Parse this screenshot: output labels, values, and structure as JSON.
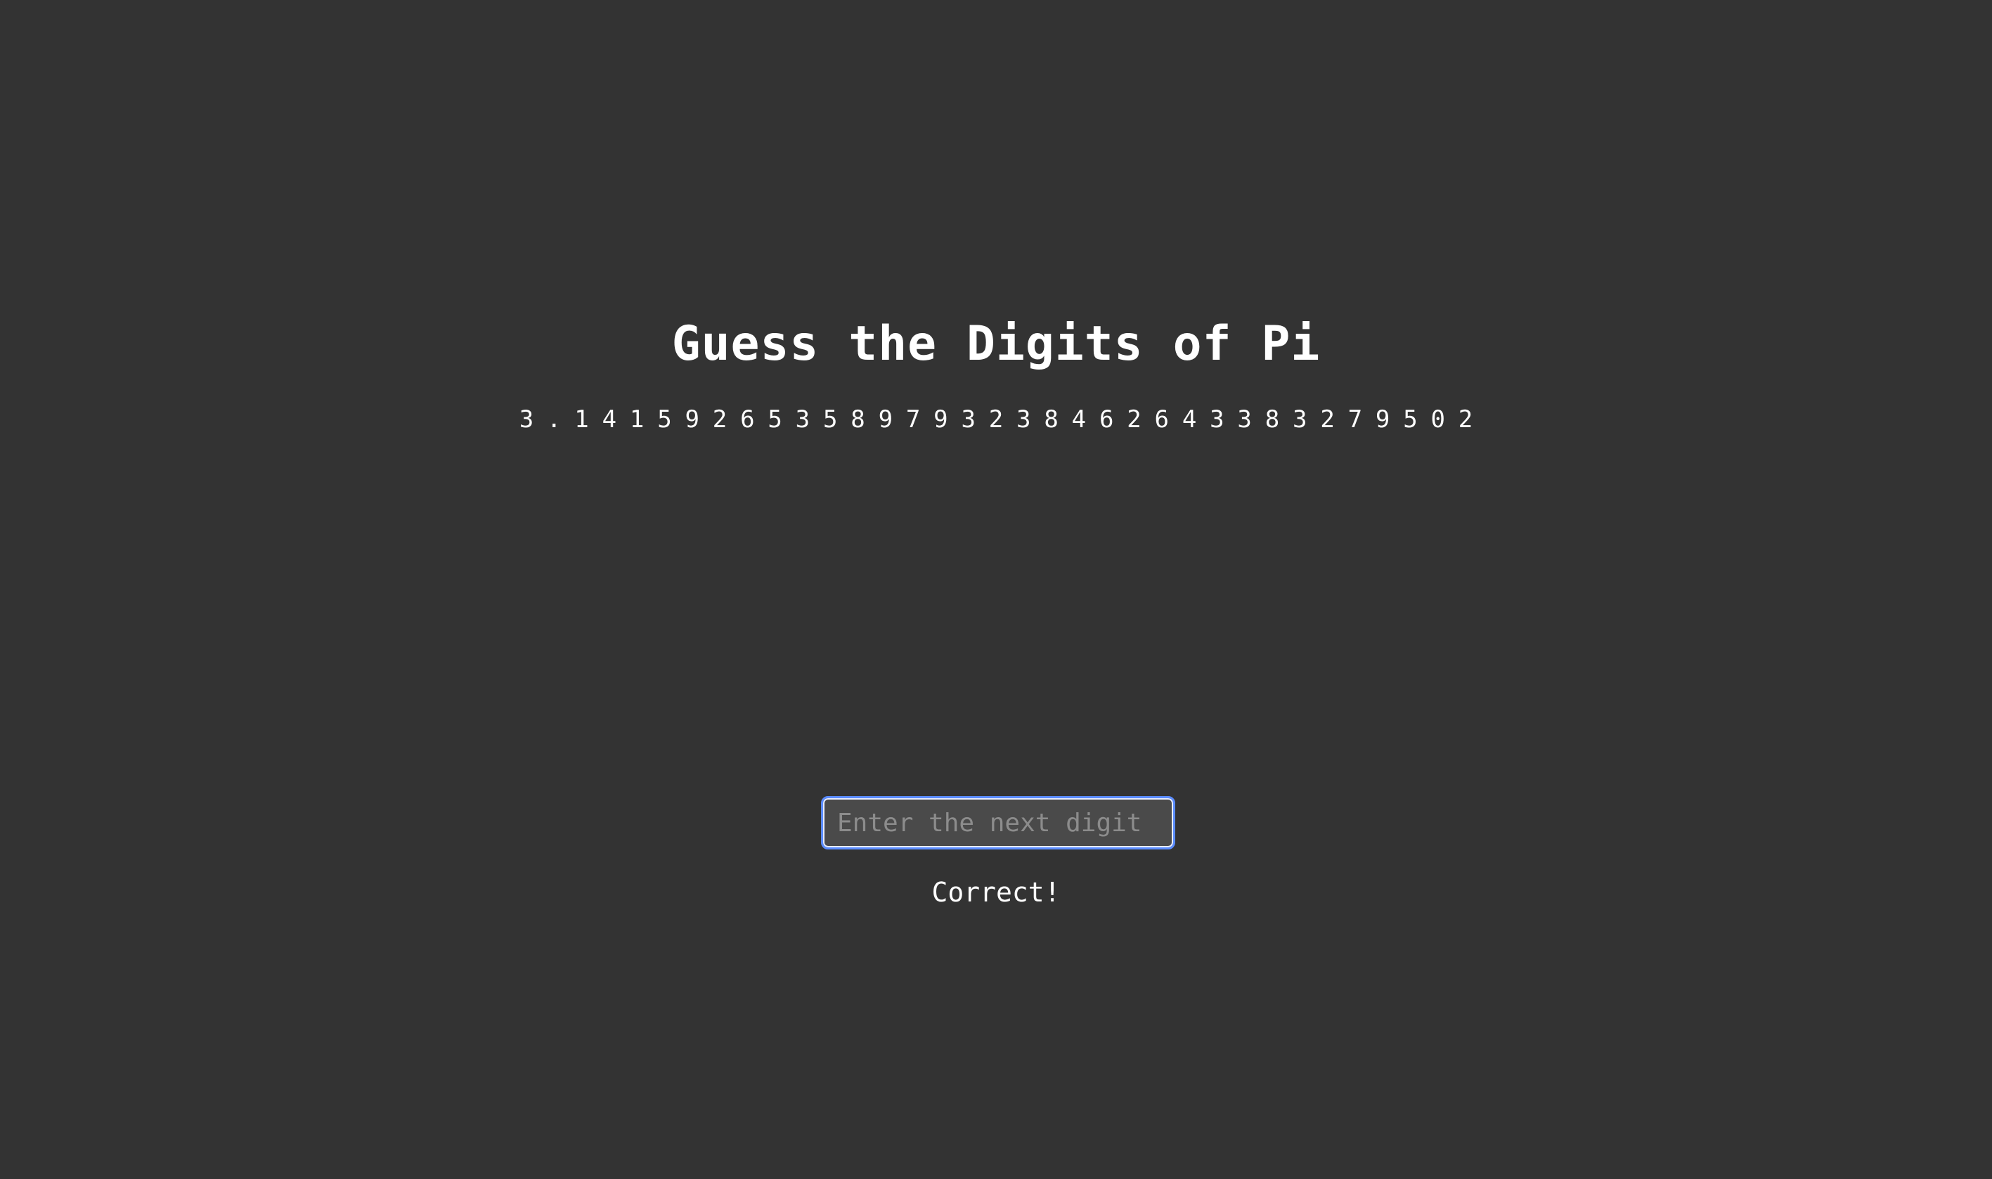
{
  "game": {
    "title": "Guess the Digits of Pi",
    "digits": [
      "3",
      ".",
      "1",
      "4",
      "1",
      "5",
      "9",
      "2",
      "6",
      "5",
      "3",
      "5",
      "8",
      "9",
      "7",
      "9",
      "3",
      "2",
      "3",
      "8",
      "4",
      "6",
      "2",
      "6",
      "4",
      "3",
      "3",
      "8",
      "3",
      "2",
      "7",
      "9",
      "5",
      "0",
      "2"
    ],
    "input": {
      "value": "",
      "placeholder": "Enter the next digit"
    },
    "feedback": "Correct!"
  },
  "colors": {
    "background": "#333333",
    "text": "#ffffff",
    "input_focus_border": "#5b8cff",
    "input_background": "#4a4a4a",
    "placeholder": "#8c8c8c"
  }
}
